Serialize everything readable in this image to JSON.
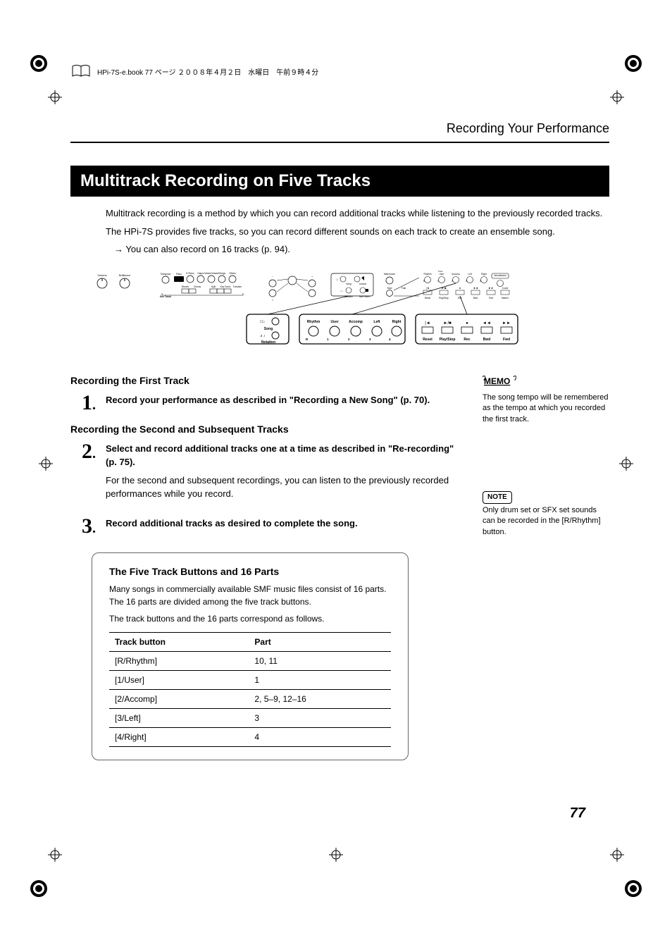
{
  "header_tag": "HPi-7S-e.book  77 ページ  ２００８年４月２日　水曜日　午前９時４分",
  "section_title": "Recording Your Performance",
  "main_heading": "Multitrack Recording on Five Tracks",
  "intro": {
    "p1": "Multitrack recording is a method by which you can record additional tracks while listening to the previously recorded tracks.",
    "p2": "The HPi-7S provides five tracks, so you can record different sounds on each track to create an ensemble song.",
    "p3": "→ You can also record on 16 tracks (p. 94)."
  },
  "sub1": "Recording the First Track",
  "step1": {
    "num": "1",
    "text": "Record your performance as described in \"Recording a New Song\" (p. 70)."
  },
  "sub2": "Recording the Second and Subsequent Tracks",
  "step2": {
    "num": "2",
    "text": "Select and record additional tracks one at a time as described in \"Re-recording\" (p. 75).",
    "body": "For the second and subsequent recordings, you can listen to the previously recorded performances while you record."
  },
  "step3": {
    "num": "3",
    "text": "Record additional tracks as desired to complete the song."
  },
  "memo": {
    "label": "MEMO",
    "text": "The song tempo will be remembered as the tempo at which you recorded the first track."
  },
  "note": {
    "label": "NOTE",
    "text": "Only drum set or SFX set sounds can be recorded in the [R/Rhythm] button."
  },
  "callout": {
    "title": "The Five Track Buttons and 16 Parts",
    "p1": "Many songs in commercially available SMF music files consist of 16 parts. The 16 parts are divided among the five track buttons.",
    "p2": "The track buttons and the 16 parts correspond as follows.",
    "table": {
      "head_col1": "Track button",
      "head_col2": "Part",
      "rows": [
        {
          "button": "[R/Rhythm]",
          "part": "10, 11"
        },
        {
          "button": "[1/User]",
          "part": "1"
        },
        {
          "button": "[2/Accomp]",
          "part": "2, 5–9, 12–16"
        },
        {
          "button": "[3/Left]",
          "part": "3"
        },
        {
          "button": "[4/Right]",
          "part": "4"
        }
      ]
    }
  },
  "page_number": "77",
  "panel": {
    "top_labels": [
      "Volume",
      "Brilliance",
      "Transpose",
      "Piano",
      "E.Piano",
      "Harpsi",
      "Celesta",
      "Strings",
      "Others",
      "Song",
      "Lesson",
      "Notation",
      "Twin Piano",
      "Metronome",
      "Slow",
      "Fast",
      "Rhythm",
      "User",
      "Accomp",
      "Left",
      "Right",
      "Wonderland",
      "Count"
    ],
    "bottom_labels": [
      "One Touch",
      "Reverb",
      "Chorus",
      "Split",
      "Key Touch",
      "Function",
      "Reset",
      "Play/Stop",
      "Rec",
      "Bwd",
      "Fwd",
      "Marker"
    ],
    "highlight_labels": [
      "Song",
      "Notation",
      "Rhythm",
      "User",
      "Accomp",
      "Left",
      "Right",
      "R",
      "1",
      "2",
      "3",
      "4",
      "Reset",
      "Play/Stop",
      "Rec",
      "Bwd",
      "Fwd"
    ]
  }
}
